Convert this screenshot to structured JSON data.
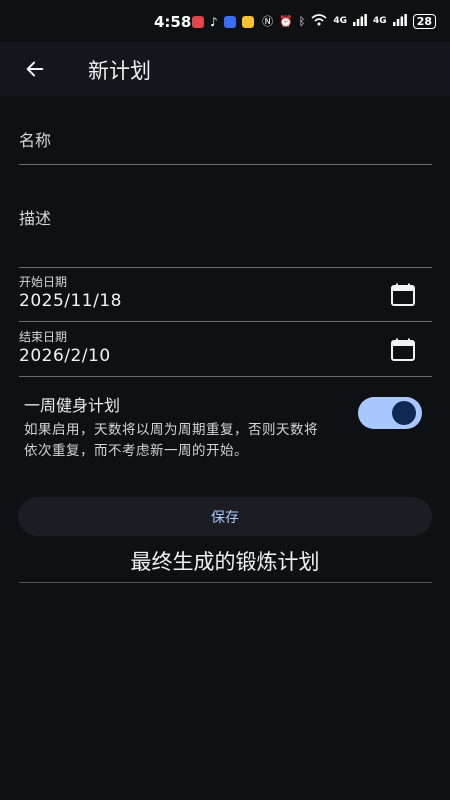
{
  "status_bar": {
    "time": "4:58",
    "network_left": "4G",
    "network_right": "4G",
    "battery": "28"
  },
  "appbar": {
    "back_icon": "arrow-left-icon",
    "title": "新计划"
  },
  "form": {
    "name_label": "名称",
    "description_label": "描述",
    "start_date": {
      "label": "开始日期",
      "value": "2025/11/18",
      "icon": "calendar-icon"
    },
    "end_date": {
      "label": "结束日期",
      "value": "2026/2/10",
      "icon": "calendar-icon"
    }
  },
  "weekly_plan": {
    "title": "一周健身计划",
    "description": "如果启用，天数将以周为周期重复，否则天数将依次重复，而不考虑新一周的开始。",
    "enabled": true
  },
  "save_button": {
    "label": "保存"
  },
  "final_section": {
    "title": "最终生成的锻炼计划"
  },
  "colors": {
    "background": "#0f1014",
    "appbar": "#15161b",
    "accent": "#a8c8ff",
    "switch_knob": "#0e2a52"
  }
}
